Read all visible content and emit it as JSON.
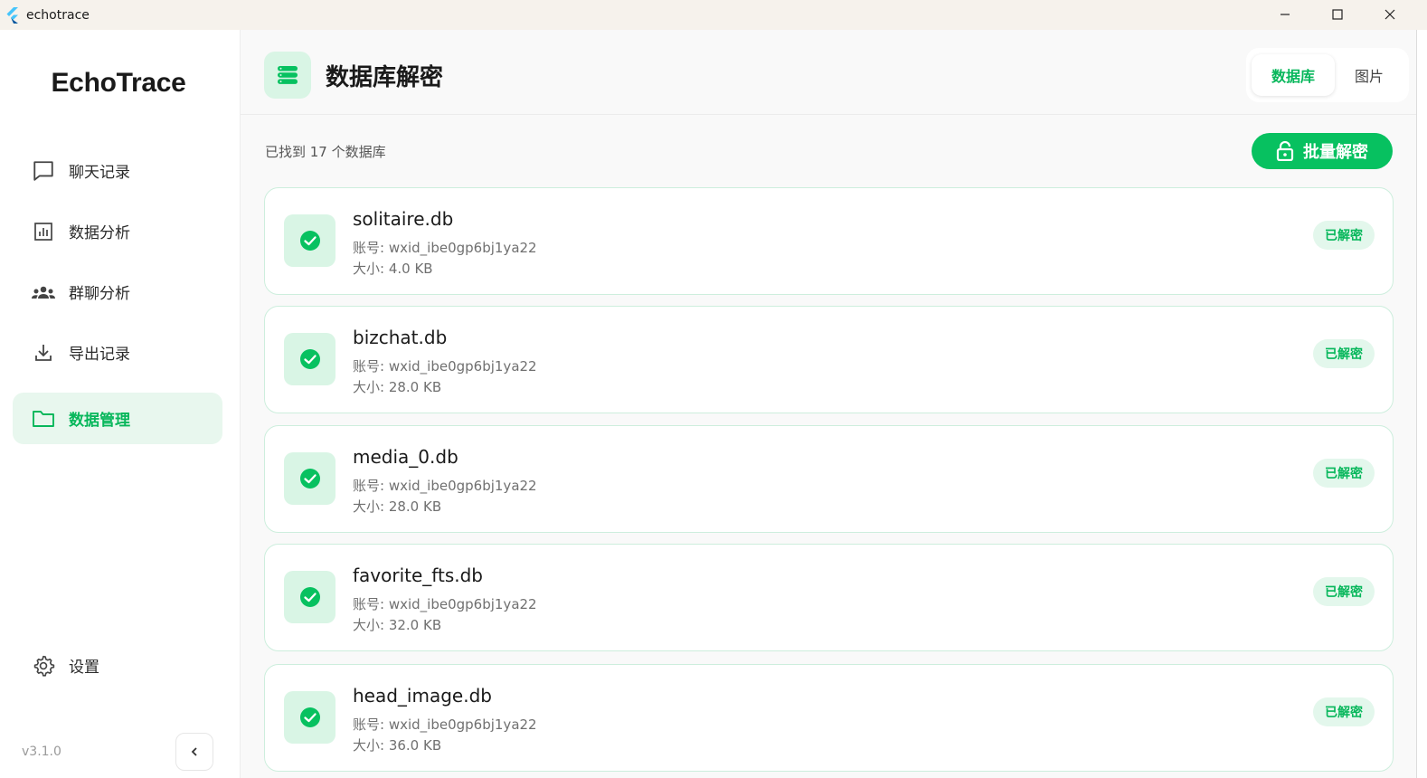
{
  "window": {
    "title": "echotrace",
    "minimize_icon": "minimize-icon",
    "maximize_icon": "maximize-icon",
    "close_icon": "close-icon"
  },
  "sidebar": {
    "brand": "EchoTrace",
    "items": [
      {
        "label": "聊天记录",
        "icon": "chat-bubble-icon",
        "active": false
      },
      {
        "label": "数据分析",
        "icon": "bar-chart-icon",
        "active": false
      },
      {
        "label": "群聊分析",
        "icon": "group-icon",
        "active": false
      },
      {
        "label": "导出记录",
        "icon": "download-icon",
        "active": false
      },
      {
        "label": "数据管理",
        "icon": "folder-icon",
        "active": true
      }
    ],
    "settings_label": "设置",
    "version": "v3.1.0"
  },
  "header": {
    "title": "数据库解密",
    "tabs": [
      {
        "label": "数据库",
        "active": true
      },
      {
        "label": "图片",
        "active": false
      }
    ]
  },
  "main": {
    "found_text": "已找到 17 个数据库",
    "batch_button": "批量解密",
    "databases": [
      {
        "name": "solitaire.db",
        "account": "账号: wxid_ibe0gp6bj1ya22",
        "size": "大小: 4.0 KB",
        "status": "已解密"
      },
      {
        "name": "bizchat.db",
        "account": "账号: wxid_ibe0gp6bj1ya22",
        "size": "大小: 28.0 KB",
        "status": "已解密"
      },
      {
        "name": "media_0.db",
        "account": "账号: wxid_ibe0gp6bj1ya22",
        "size": "大小: 28.0 KB",
        "status": "已解密"
      },
      {
        "name": "favorite_fts.db",
        "account": "账号: wxid_ibe0gp6bj1ya22",
        "size": "大小: 32.0 KB",
        "status": "已解密"
      },
      {
        "name": "head_image.db",
        "account": "账号: wxid_ibe0gp6bj1ya22",
        "size": "大小: 36.0 KB",
        "status": "已解密"
      }
    ]
  },
  "colors": {
    "accent": "#07c160",
    "accent_text": "#07b75b",
    "accent_light": "#e8f7ee",
    "titlebar": "#f6f2ec"
  }
}
